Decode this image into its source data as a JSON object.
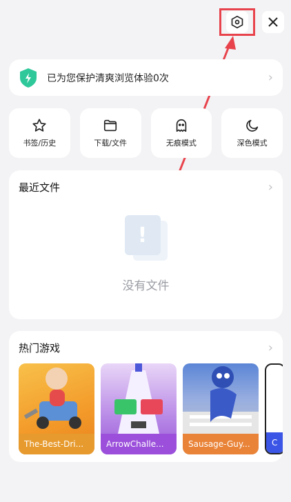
{
  "protect": {
    "text": "已为您保护清爽浏览体验0次"
  },
  "quick_actions": [
    {
      "label": "书签/历史",
      "icon": "star-icon"
    },
    {
      "label": "下载/文件",
      "icon": "folder-icon"
    },
    {
      "label": "无痕模式",
      "icon": "ghost-icon"
    },
    {
      "label": "深色模式",
      "icon": "moon-icon"
    }
  ],
  "recent": {
    "title": "最近文件",
    "empty_text": "没有文件",
    "empty_mark": "!"
  },
  "games": {
    "title": "热门游戏",
    "items": [
      {
        "name": "The-Best-Dri..."
      },
      {
        "name": "ArrowChalle..."
      },
      {
        "name": "Sausage-Guy..."
      },
      {
        "name": "C"
      }
    ]
  },
  "colors": {
    "highlight": "#e8434c",
    "accent_green": "#2ec89a"
  }
}
